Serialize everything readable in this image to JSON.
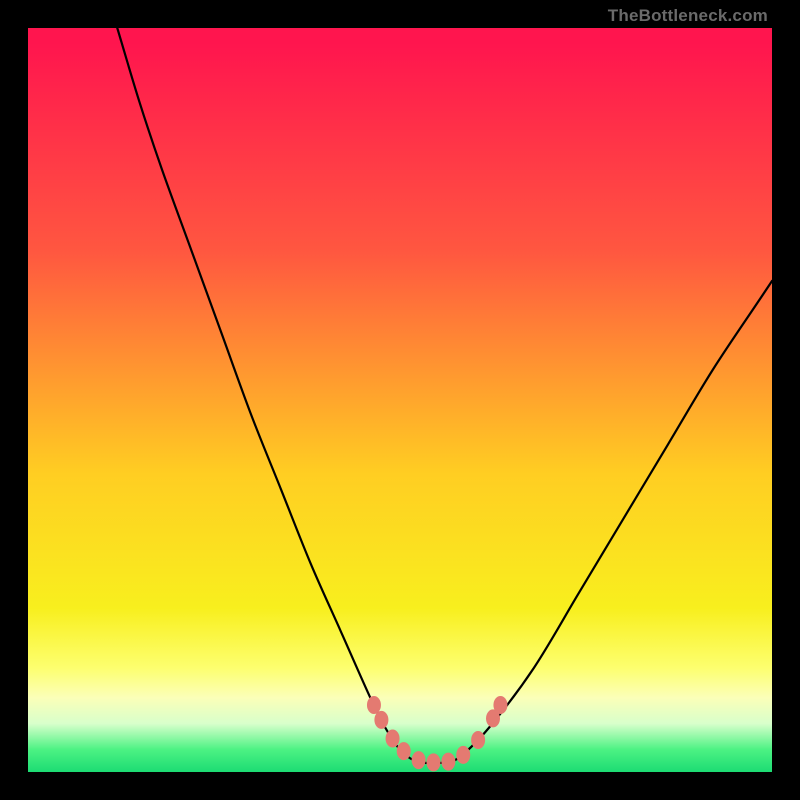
{
  "watermark": "TheBottleneck.com",
  "chart_data": {
    "type": "line",
    "title": "",
    "xlabel": "",
    "ylabel": "",
    "xlim": [
      0,
      100
    ],
    "ylim": [
      0,
      100
    ],
    "grid": false,
    "legend": false,
    "series": [
      {
        "name": "bottleneck-curve",
        "x": [
          12,
          15,
          18,
          22,
          26,
          30,
          34,
          38,
          42,
          46,
          48,
          50,
          52,
          54,
          56,
          58,
          62,
          68,
          74,
          80,
          86,
          92,
          98,
          100
        ],
        "y": [
          100,
          90,
          81,
          70,
          59,
          48,
          38,
          28,
          19,
          10,
          6,
          3,
          1.5,
          1.2,
          1.3,
          2,
          6,
          14,
          24,
          34,
          44,
          54,
          63,
          66
        ]
      }
    ],
    "markers": {
      "name": "highlight-dots",
      "points": [
        {
          "x": 46.5,
          "y": 9.0
        },
        {
          "x": 47.5,
          "y": 7.0
        },
        {
          "x": 49.0,
          "y": 4.5
        },
        {
          "x": 50.5,
          "y": 2.8
        },
        {
          "x": 52.5,
          "y": 1.6
        },
        {
          "x": 54.5,
          "y": 1.3
        },
        {
          "x": 56.5,
          "y": 1.4
        },
        {
          "x": 58.5,
          "y": 2.3
        },
        {
          "x": 60.5,
          "y": 4.3
        },
        {
          "x": 62.5,
          "y": 7.2
        },
        {
          "x": 63.5,
          "y": 9.0
        }
      ]
    },
    "gradient_stops": [
      {
        "pos": 0.0,
        "color": "#ff154e"
      },
      {
        "pos": 0.3,
        "color": "#ff5740"
      },
      {
        "pos": 0.6,
        "color": "#ffce22"
      },
      {
        "pos": 0.86,
        "color": "#fdff6f"
      },
      {
        "pos": 0.93,
        "color": "#d8ffcb"
      },
      {
        "pos": 1.0,
        "color": "#1cdc73"
      }
    ]
  }
}
